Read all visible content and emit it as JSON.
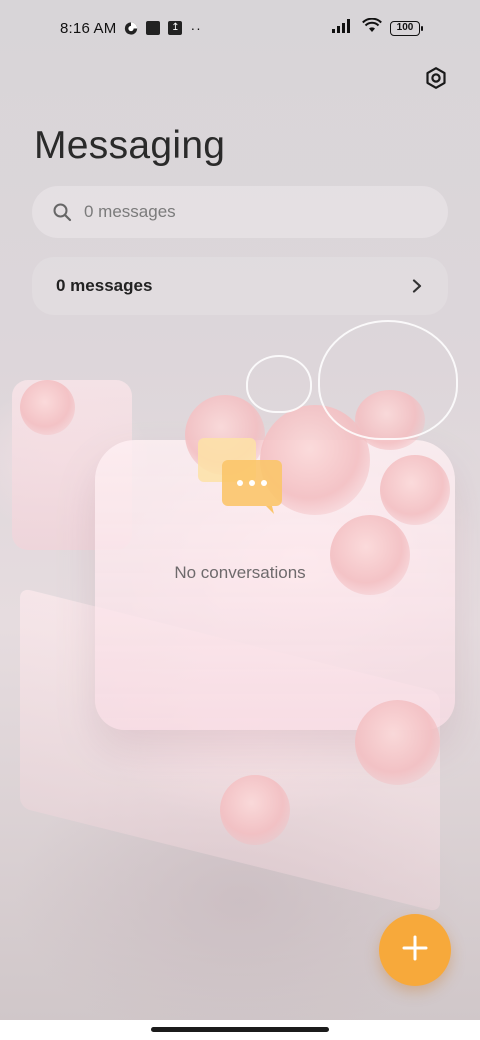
{
  "status_bar": {
    "time": "8:16 AM",
    "battery": "100",
    "icons": [
      "data-saver-icon",
      "app-square-icon",
      "upload-icon",
      "more-dots-icon",
      "signal-icon",
      "wifi-icon",
      "battery-icon"
    ]
  },
  "header": {
    "title": "Messaging",
    "settings_icon": "settings-icon"
  },
  "search": {
    "placeholder": "0 messages"
  },
  "messages_row": {
    "label": "0 messages"
  },
  "empty_state": {
    "text": "No conversations",
    "icon": "chat-bubbles-icon"
  },
  "fab": {
    "icon": "plus-icon",
    "color": "#f7a93b"
  },
  "colors": {
    "accent": "#f7a93b",
    "title": "#2a2a2a",
    "muted": "#6e6a6c"
  }
}
